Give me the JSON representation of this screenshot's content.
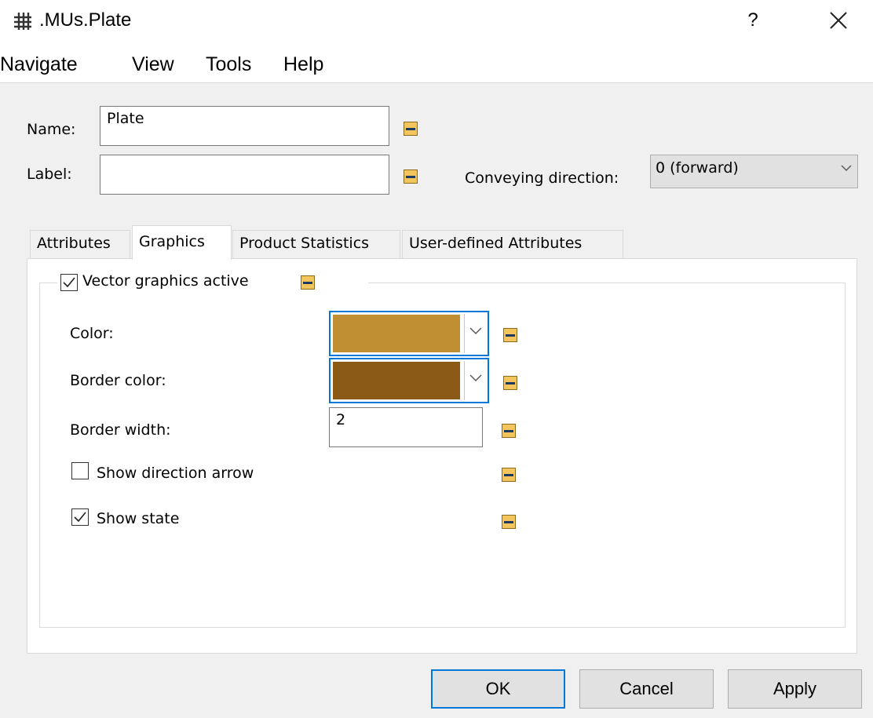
{
  "window": {
    "title": ".MUs.Plate",
    "help_label": "?"
  },
  "menu": [
    "Navigate",
    "View",
    "Tools",
    "Help"
  ],
  "form": {
    "name_label": "Name:",
    "name_value": "Plate",
    "label_label": "Label:",
    "label_value": "",
    "conveying_label": "Conveying direction:",
    "conveying_value": "0 (forward)"
  },
  "tabs": [
    "Attributes",
    "Graphics",
    "Product Statistics",
    "User-defined Attributes"
  ],
  "active_tab": "Graphics",
  "graphics": {
    "vector_active_label": "Vector graphics active",
    "vector_active_checked": true,
    "color_label": "Color:",
    "color_value": "#c18f33",
    "border_color_label": "Border color:",
    "border_color_value": "#8b5a16",
    "border_width_label": "Border width:",
    "border_width_value": "2",
    "show_arrow_label": "Show direction arrow",
    "show_arrow_checked": false,
    "show_state_label": "Show state",
    "show_state_checked": true
  },
  "buttons": {
    "ok": "OK",
    "cancel": "Cancel",
    "apply": "Apply"
  },
  "colors": {
    "lock_fill": "#f4c55c",
    "lock_bar": "#1f3a60",
    "focus_border": "#0078d7"
  }
}
